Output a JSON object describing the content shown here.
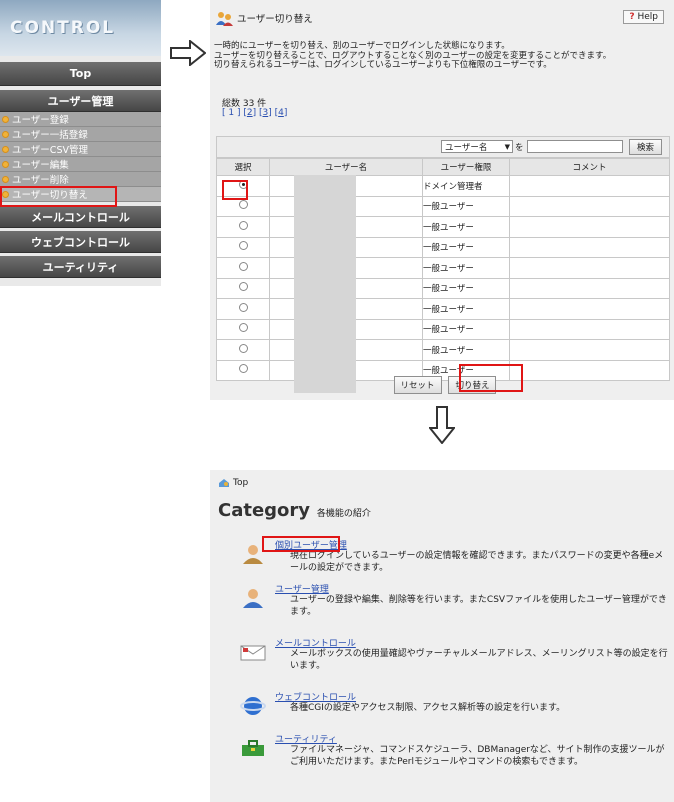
{
  "sidebar": {
    "logo_text": "CONTROL",
    "top_label": "Top",
    "section_user": "ユーザー管理",
    "user_items": [
      "ユーザー登録",
      "ユーザー一括登録",
      "ユーザーCSV管理",
      "ユーザー編集",
      "ユーザー削除",
      "ユーザー切り替え"
    ],
    "mail_control": "メールコントロール",
    "web_control": "ウェブコントロール",
    "utility": "ユーティリティ"
  },
  "switch_page": {
    "title": "ユーザー切り替え",
    "help": "Help",
    "help_mark": "?",
    "desc1": "一時的にユーザーを切り替え、別のユーザーでログインした状態になります。",
    "desc2": "ユーザーを切り替えることで、ログアウトすることなく別のユーザーの設定を変更することができます。",
    "desc3": "切り替えられるユーザーは、ログインしているユーザーよりも下位権限のユーザーです。",
    "total": "総数 33 件",
    "pager_current": "[ 1 ]",
    "pager_links": [
      "2",
      "3",
      "4"
    ],
    "search_select": "ユーザー名",
    "search_suffix": "を",
    "search_value": "",
    "search_button": "検索",
    "columns": [
      "選択",
      "ユーザー名",
      "ユーザー権限",
      "コメント"
    ],
    "rows": [
      {
        "selected": true,
        "role": "ドメイン管理者"
      },
      {
        "selected": false,
        "role": "一般ユーザー"
      },
      {
        "selected": false,
        "role": "一般ユーザー"
      },
      {
        "selected": false,
        "role": "一般ユーザー"
      },
      {
        "selected": false,
        "role": "一般ユーザー"
      },
      {
        "selected": false,
        "role": "一般ユーザー"
      },
      {
        "selected": false,
        "role": "一般ユーザー"
      },
      {
        "selected": false,
        "role": "一般ユーザー"
      },
      {
        "selected": false,
        "role": "一般ユーザー"
      },
      {
        "selected": false,
        "role": "一般ユーザー"
      }
    ],
    "reset_button": "リセット",
    "switch_button": "切り替え"
  },
  "top_page": {
    "breadcrumb": "Top",
    "heading": "Category",
    "heading_sub": "各機能の紹介",
    "categories": [
      {
        "link": "個別ユーザー管理",
        "desc": "現在ログインしているユーザーの設定情報を確認できます。またパスワードの変更や各種eメールの設定ができます。"
      },
      {
        "link": "ユーザー管理",
        "desc": "ユーザーの登録や編集、削除等を行います。またCSVファイルを使用したユーザー管理ができます。"
      },
      {
        "link": "メールコントロール",
        "desc": "メールボックスの使用量確認やヴァーチャルメールアドレス、メーリングリスト等の設定を行います。"
      },
      {
        "link": "ウェブコントロール",
        "desc": "各種CGIの設定やアクセス制限、アクセス解析等の設定を行います。"
      },
      {
        "link": "ユーティリティ",
        "desc": "ファイルマネージャ、コマンドスケジューラ、DBManagerなど、サイト制作の支援ツールがご利用いただけます。またPerlモジュールやコマンドの検索もできます。"
      }
    ]
  }
}
